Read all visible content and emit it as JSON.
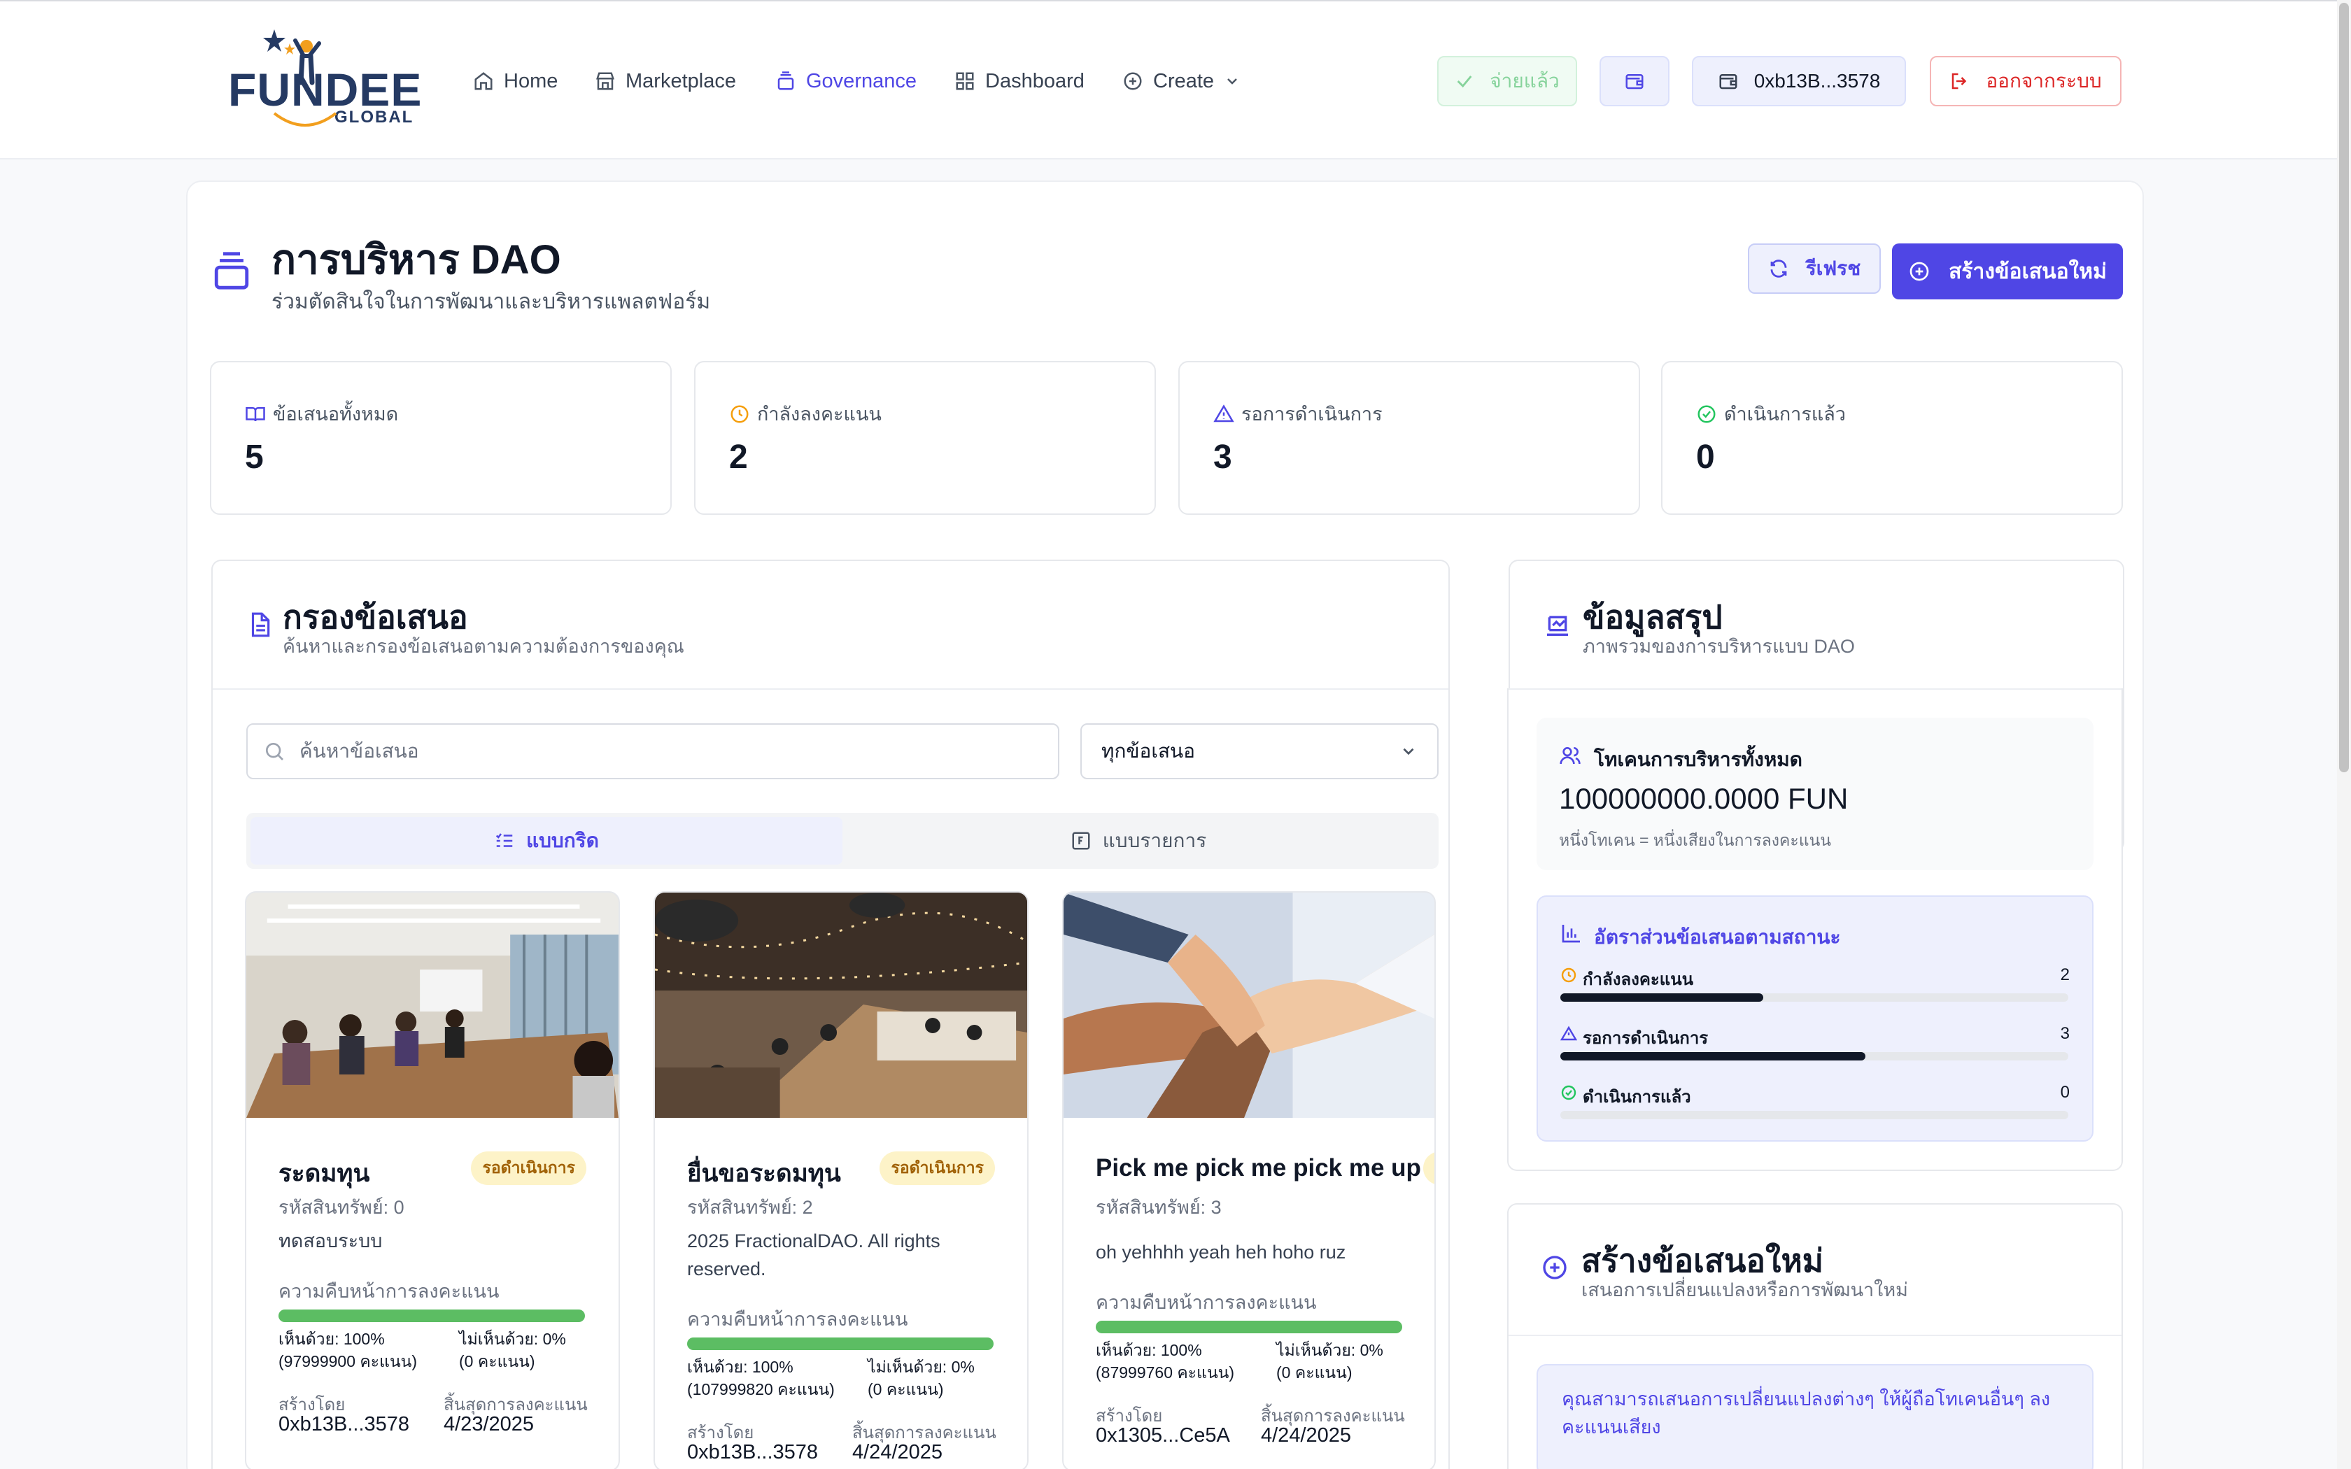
{
  "header": {
    "logo_main": "FUNDEE",
    "logo_sub": "GLOBAL",
    "nav": [
      {
        "label": "Home",
        "icon": "home-icon"
      },
      {
        "label": "Marketplace",
        "icon": "store-icon"
      },
      {
        "label": "Governance",
        "icon": "governance-icon",
        "active": true
      },
      {
        "label": "Dashboard",
        "icon": "dashboard-icon"
      },
      {
        "label": "Create",
        "icon": "plus-circle-icon"
      }
    ],
    "paid_label": "จ่ายแล้ว",
    "wallet_address": "0xb13B...3578",
    "logout_label": "ออกจากระบบ"
  },
  "page": {
    "title": "การบริหาร DAO",
    "subtitle": "ร่วมตัดสินใจในการพัฒนาและบริหารแพลตฟอร์ม",
    "refresh_label": "รีเฟรช",
    "new_proposal_label": "สร้างข้อเสนอใหม่"
  },
  "stats": [
    {
      "label": "ข้อเสนอทั้งหมด",
      "value": "5",
      "icon": "book-icon",
      "color": "#4f46e5"
    },
    {
      "label": "กำลังลงคะแนน",
      "value": "2",
      "icon": "clock-icon",
      "color": "#f59e0b"
    },
    {
      "label": "รอการดำเนินการ",
      "value": "3",
      "icon": "warning-icon",
      "color": "#4f46e5"
    },
    {
      "label": "ดำเนินการแล้ว",
      "value": "0",
      "icon": "check-circle-icon",
      "color": "#22c55e"
    }
  ],
  "filter": {
    "title": "กรองข้อเสนอ",
    "subtitle": "ค้นหาและกรองข้อเสนอตามความต้องการของคุณ",
    "search_placeholder": "ค้นหาข้อเสนอ",
    "select_value": "ทุกข้อเสนอ",
    "tab_grid": "แบบกริด",
    "tab_list": "แบบรายการ"
  },
  "proposals": [
    {
      "title": "ระดมทุน",
      "status": "รอดำเนินการ",
      "asset_id": "รหัสสินทรัพย์: 0",
      "description": "ทดสอบระบบ",
      "progress_label": "ความคืบหน้าการลงคะแนน",
      "progress": 1.0,
      "for_text": "เห็นด้วย: 100%",
      "for_votes": "(97999900 คะแนน)",
      "against_text": "ไม่เห็นด้วย: 0%",
      "against_votes": "(0 คะแนน)",
      "created_by_label": "สร้างโดย",
      "created_by": "0xb13B...3578",
      "end_label": "สิ้นสุดการลงคะแนน",
      "end_date": "4/23/2025"
    },
    {
      "title": "ยื่นขอระดมทุน",
      "status": "รอดำเนินการ",
      "asset_id": "รหัสสินทรัพย์: 2",
      "description": "2025 FractionalDAO. All rights reserved.",
      "progress_label": "ความคืบหน้าการลงคะแนน",
      "progress": 1.0,
      "for_text": "เห็นด้วย: 100%",
      "for_votes": "(107999820 คะแนน)",
      "against_text": "ไม่เห็นด้วย: 0%",
      "against_votes": "(0 คะแนน)",
      "created_by_label": "สร้างโดย",
      "created_by": "0xb13B...3578",
      "end_label": "สิ้นสุดการลงคะแนน",
      "end_date": "4/24/2025"
    },
    {
      "title": "Pick me pick me pick me up",
      "status": "รอดำเนินการ",
      "asset_id": "รหัสสินทรัพย์: 3",
      "description": "oh yehhhh yeah heh hoho ruz",
      "progress_label": "ความคืบหน้าการลงคะแนน",
      "progress": 1.0,
      "for_text": "เห็นด้วย: 100%",
      "for_votes": "(87999760 คะแนน)",
      "against_text": "ไม่เห็นด้วย: 0%",
      "against_votes": "(0 คะแนน)",
      "created_by_label": "สร้างโดย",
      "created_by": "0x1305...Ce5A",
      "end_label": "สิ้นสุดการลงคะแนน",
      "end_date": "4/24/2025"
    }
  ],
  "summary": {
    "title": "ข้อมูลสรุป",
    "subtitle": "ภาพรวมของการบริหารแบบ DAO",
    "tokens_label": "โทเคนการบริหารทั้งหมด",
    "tokens_value": "100000000.0000 FUN",
    "tokens_note": "หนึ่งโทเคน = หนึ่งเสียงในการลงคะแนน",
    "ratio_title": "อัตราส่วนข้อเสนอตามสถานะ",
    "ratios": [
      {
        "label": "กำลังลงคะแนน",
        "count": "2",
        "fraction": 0.4,
        "color": "#f59e0b"
      },
      {
        "label": "รอการดำเนินการ",
        "count": "3",
        "fraction": 0.6,
        "color": "#4f46e5"
      },
      {
        "label": "ดำเนินการแล้ว",
        "count": "0",
        "fraction": 0.0,
        "color": "#22c55e"
      }
    ]
  },
  "create": {
    "title": "สร้างข้อเสนอใหม่",
    "subtitle": "เสนอการเปลี่ยนแปลงหรือการพัฒนาใหม่",
    "info": "คุณสามารถเสนอการเปลี่ยนแปลงต่างๆ ให้ผู้ถือโทเคนอื่นๆ ลงคะแนนเสียง"
  },
  "colors": {
    "primary": "#4f46e5",
    "success": "#22c55e",
    "danger": "#dc2626",
    "warning": "#f59e0b"
  }
}
